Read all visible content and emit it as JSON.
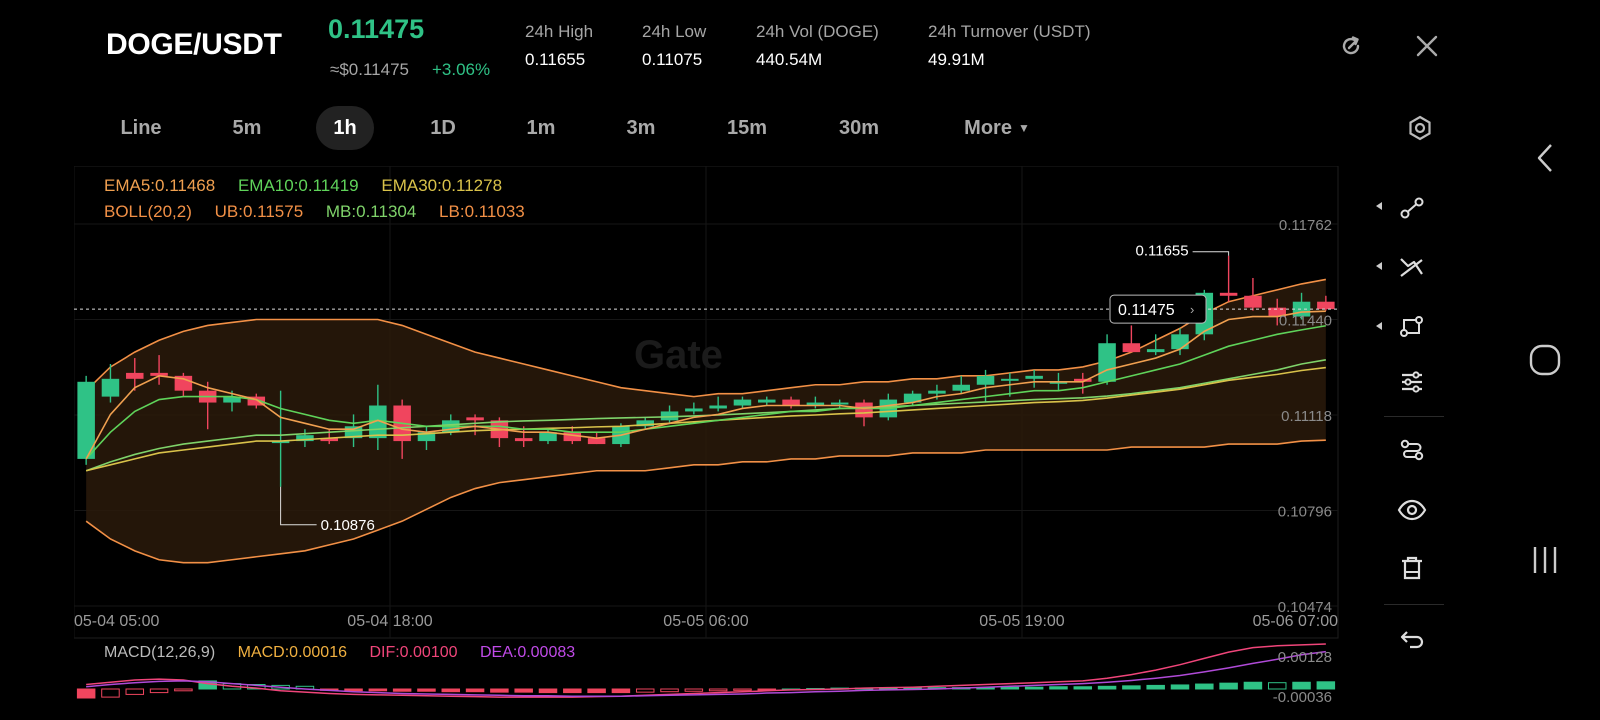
{
  "header": {
    "pair": "DOGE/USDT",
    "last_price": "0.11475",
    "approx_usd": "≈$0.11475",
    "change_pct": "+3.06%",
    "stats": [
      {
        "label": "24h   High",
        "value": "0.11655"
      },
      {
        "label": "24h   Low",
        "value": "0.11075"
      },
      {
        "label": "24h   Vol (DOGE)",
        "value": "440.54M"
      },
      {
        "label": "24h   Turnover (USDT)",
        "value": "49.91M"
      }
    ]
  },
  "timeframes": [
    "Line",
    "5m",
    "1h",
    "1D",
    "1m",
    "3m",
    "15m",
    "30m",
    "More"
  ],
  "active_timeframe": "1h",
  "indicators": {
    "ema5": "EMA5:0.11468",
    "ema10": "EMA10:0.11419",
    "ema30": "EMA30:0.11278",
    "boll": "BOLL(20,2)",
    "ub": "UB:0.11575",
    "mb": "MB:0.11304",
    "lb": "LB:0.11033"
  },
  "watermark": "Gate",
  "price_axis": [
    "0.11762",
    "0.11440",
    "0.11118",
    "0.10796",
    "0.10474"
  ],
  "time_axis": [
    "05-04 05:00",
    "05-04 18:00",
    "05-05 06:00",
    "05-05 19:00",
    "05-06 07:00"
  ],
  "annotations": {
    "high": "0.11655",
    "low": "0.10876",
    "current": "0.11475"
  },
  "macd": {
    "title": "MACD(12,26,9)",
    "macd": "MACD:0.00016",
    "dif": "DIF:0.00100",
    "dea": "DEA:0.00083",
    "axis_top": "0.00128",
    "axis_bottom": "-0.00036"
  },
  "colors": {
    "up": "#2fc286",
    "down": "#f0455e",
    "ema5": "#f0a050",
    "ema10": "#5fd35a",
    "ema30": "#d9c24a",
    "boll": "#f29046",
    "mb": "#7fd36a",
    "dif": "#f0457a",
    "dea": "#b04ad8"
  },
  "chart_data": {
    "type": "candlestick",
    "interval": "1h",
    "ylim": [
      0.10474,
      0.11762
    ],
    "candles": [
      {
        "o": 0.1097,
        "h": 0.1125,
        "l": 0.1095,
        "c": 0.1123
      },
      {
        "o": 0.1118,
        "h": 0.1129,
        "l": 0.1116,
        "c": 0.1124
      },
      {
        "o": 0.1126,
        "h": 0.1131,
        "l": 0.112,
        "c": 0.1124
      },
      {
        "o": 0.1126,
        "h": 0.1132,
        "l": 0.1122,
        "c": 0.1125
      },
      {
        "o": 0.1125,
        "h": 0.1126,
        "l": 0.1118,
        "c": 0.112
      },
      {
        "o": 0.112,
        "h": 0.1123,
        "l": 0.1107,
        "c": 0.1116
      },
      {
        "o": 0.1116,
        "h": 0.112,
        "l": 0.1113,
        "c": 0.1118
      },
      {
        "o": 0.1118,
        "h": 0.1119,
        "l": 0.1114,
        "c": 0.1115
      },
      {
        "o": 0.1103,
        "h": 0.112,
        "l": 0.10876,
        "c": 0.1103
      },
      {
        "o": 0.1103,
        "h": 0.1107,
        "l": 0.1101,
        "c": 0.1105
      },
      {
        "o": 0.1104,
        "h": 0.1107,
        "l": 0.1102,
        "c": 0.1103
      },
      {
        "o": 0.1104,
        "h": 0.1112,
        "l": 0.1101,
        "c": 0.1108
      },
      {
        "o": 0.1104,
        "h": 0.1122,
        "l": 0.11,
        "c": 0.1115
      },
      {
        "o": 0.1115,
        "h": 0.1117,
        "l": 0.1097,
        "c": 0.1103
      },
      {
        "o": 0.1103,
        "h": 0.1108,
        "l": 0.11,
        "c": 0.1106
      },
      {
        "o": 0.1106,
        "h": 0.1112,
        "l": 0.1105,
        "c": 0.111
      },
      {
        "o": 0.1111,
        "h": 0.1112,
        "l": 0.1105,
        "c": 0.111
      },
      {
        "o": 0.111,
        "h": 0.1111,
        "l": 0.1101,
        "c": 0.1104
      },
      {
        "o": 0.1104,
        "h": 0.1108,
        "l": 0.1101,
        "c": 0.1103
      },
      {
        "o": 0.1103,
        "h": 0.1107,
        "l": 0.1102,
        "c": 0.1106
      },
      {
        "o": 0.1106,
        "h": 0.1108,
        "l": 0.1102,
        "c": 0.1103
      },
      {
        "o": 0.1104,
        "h": 0.1106,
        "l": 0.1102,
        "c": 0.1102
      },
      {
        "o": 0.1102,
        "h": 0.1109,
        "l": 0.1101,
        "c": 0.1108
      },
      {
        "o": 0.1108,
        "h": 0.1111,
        "l": 0.1107,
        "c": 0.111
      },
      {
        "o": 0.111,
        "h": 0.1115,
        "l": 0.1109,
        "c": 0.1113
      },
      {
        "o": 0.1113,
        "h": 0.1116,
        "l": 0.1112,
        "c": 0.1114
      },
      {
        "o": 0.1114,
        "h": 0.1118,
        "l": 0.1113,
        "c": 0.1115
      },
      {
        "o": 0.1115,
        "h": 0.1118,
        "l": 0.1114,
        "c": 0.1117
      },
      {
        "o": 0.1116,
        "h": 0.1118,
        "l": 0.1115,
        "c": 0.1117
      },
      {
        "o": 0.1117,
        "h": 0.1118,
        "l": 0.1114,
        "c": 0.1115
      },
      {
        "o": 0.1115,
        "h": 0.1118,
        "l": 0.1114,
        "c": 0.1116
      },
      {
        "o": 0.1116,
        "h": 0.1117,
        "l": 0.1114,
        "c": 0.1116
      },
      {
        "o": 0.1116,
        "h": 0.1117,
        "l": 0.1108,
        "c": 0.1111
      },
      {
        "o": 0.1111,
        "h": 0.1119,
        "l": 0.111,
        "c": 0.1117
      },
      {
        "o": 0.1116,
        "h": 0.112,
        "l": 0.1115,
        "c": 0.1119
      },
      {
        "o": 0.1119,
        "h": 0.1122,
        "l": 0.1117,
        "c": 0.112
      },
      {
        "o": 0.112,
        "h": 0.1125,
        "l": 0.1119,
        "c": 0.1122
      },
      {
        "o": 0.1122,
        "h": 0.1127,
        "l": 0.1116,
        "c": 0.1125
      },
      {
        "o": 0.1124,
        "h": 0.1126,
        "l": 0.1118,
        "c": 0.1124
      },
      {
        "o": 0.1124,
        "h": 0.1127,
        "l": 0.1121,
        "c": 0.1125
      },
      {
        "o": 0.1123,
        "h": 0.1126,
        "l": 0.112,
        "c": 0.1123
      },
      {
        "o": 0.1124,
        "h": 0.1126,
        "l": 0.1119,
        "c": 0.1123
      },
      {
        "o": 0.1123,
        "h": 0.1139,
        "l": 0.1122,
        "c": 0.1136
      },
      {
        "o": 0.1136,
        "h": 0.1142,
        "l": 0.1133,
        "c": 0.1133
      },
      {
        "o": 0.1133,
        "h": 0.1139,
        "l": 0.1132,
        "c": 0.1134
      },
      {
        "o": 0.1134,
        "h": 0.1141,
        "l": 0.1132,
        "c": 0.1139
      },
      {
        "o": 0.1139,
        "h": 0.1154,
        "l": 0.1137,
        "c": 0.1153
      },
      {
        "o": 0.1153,
        "h": 0.11655,
        "l": 0.115,
        "c": 0.1152
      },
      {
        "o": 0.1152,
        "h": 0.1158,
        "l": 0.1147,
        "c": 0.1148
      },
      {
        "o": 0.1148,
        "h": 0.1151,
        "l": 0.1142,
        "c": 0.1145
      },
      {
        "o": 0.1145,
        "h": 0.1153,
        "l": 0.1144,
        "c": 0.115
      },
      {
        "o": 0.115,
        "h": 0.1152,
        "l": 0.1147,
        "c": 0.11475
      }
    ],
    "ema5": [
      0.1097,
      0.1112,
      0.1121,
      0.1125,
      0.1124,
      0.1121,
      0.1119,
      0.1117,
      0.1111,
      0.1109,
      0.1107,
      0.1107,
      0.111,
      0.1107,
      0.1106,
      0.1107,
      0.1108,
      0.1107,
      0.1106,
      0.1106,
      0.1105,
      0.1104,
      0.1105,
      0.1107,
      0.1109,
      0.1111,
      0.1112,
      0.1114,
      0.1115,
      0.1115,
      0.1115,
      0.1115,
      0.1114,
      0.1115,
      0.1116,
      0.1118,
      0.1119,
      0.1121,
      0.1122,
      0.1123,
      0.1123,
      0.1123,
      0.1127,
      0.1129,
      0.1131,
      0.1134,
      0.114,
      0.1144,
      0.1145,
      0.1145,
      0.11465,
      0.11468
    ],
    "ema10": [
      0.1097,
      0.1106,
      0.1113,
      0.1117,
      0.1118,
      0.1118,
      0.1118,
      0.1117,
      0.1114,
      0.1112,
      0.111,
      0.1109,
      0.111,
      0.1109,
      0.1108,
      0.1108,
      0.1108,
      0.1108,
      0.1107,
      0.1107,
      0.1106,
      0.1106,
      0.1106,
      0.1107,
      0.1108,
      0.1109,
      0.111,
      0.1111,
      0.1112,
      0.1113,
      0.1113,
      0.1114,
      0.1114,
      0.1114,
      0.1115,
      0.1116,
      0.1117,
      0.1118,
      0.1119,
      0.112,
      0.112,
      0.1121,
      0.1123,
      0.1125,
      0.1127,
      0.1129,
      0.1132,
      0.1135,
      0.1137,
      0.1139,
      0.11405,
      0.11419
    ],
    "ema30": [
      0.1093,
      0.1095,
      0.1097,
      0.1099,
      0.11,
      0.1101,
      0.1102,
      0.1103,
      0.1103,
      0.11035,
      0.1104,
      0.11045,
      0.1105,
      0.1105,
      0.11055,
      0.1106,
      0.11065,
      0.11068,
      0.1107,
      0.11073,
      0.11075,
      0.11078,
      0.1108,
      0.11085,
      0.1109,
      0.11095,
      0.111,
      0.11105,
      0.1111,
      0.11115,
      0.11118,
      0.11122,
      0.11125,
      0.1113,
      0.11135,
      0.1114,
      0.11145,
      0.1115,
      0.11155,
      0.1116,
      0.11163,
      0.11167,
      0.11175,
      0.11185,
      0.11195,
      0.11205,
      0.1122,
      0.11235,
      0.11245,
      0.11255,
      0.11268,
      0.11278
    ],
    "mb": [
      0.1093,
      0.1096,
      0.10985,
      0.11005,
      0.1102,
      0.1103,
      0.1104,
      0.1105,
      0.1105,
      0.11055,
      0.1106,
      0.11065,
      0.1107,
      0.11075,
      0.1108,
      0.11085,
      0.1109,
      0.11095,
      0.11098,
      0.111,
      0.11103,
      0.11106,
      0.11108,
      0.1111,
      0.11112,
      0.11115,
      0.11118,
      0.11122,
      0.11126,
      0.1113,
      0.11135,
      0.1114,
      0.11143,
      0.11146,
      0.1115,
      0.11154,
      0.11158,
      0.11162,
      0.11166,
      0.1117,
      0.11173,
      0.11176,
      0.11182,
      0.1119,
      0.112,
      0.1121,
      0.11225,
      0.1124,
      0.11255,
      0.1127,
      0.1129,
      0.11304
    ],
    "ub": [
      0.112,
      0.1128,
      0.1133,
      0.1137,
      0.114,
      0.1142,
      0.1143,
      0.1144,
      0.1144,
      0.1144,
      0.1144,
      0.1144,
      0.1144,
      0.1142,
      0.1139,
      0.1136,
      0.1133,
      0.1131,
      0.1129,
      0.1127,
      0.1125,
      0.1123,
      0.1121,
      0.112,
      0.1119,
      0.1118,
      0.1119,
      0.1119,
      0.112,
      0.1121,
      0.1122,
      0.1122,
      0.1123,
      0.1123,
      0.1124,
      0.1124,
      0.1125,
      0.1125,
      0.1126,
      0.1127,
      0.1127,
      0.1128,
      0.113,
      0.1133,
      0.1137,
      0.1141,
      0.1146,
      0.115,
      0.1152,
      0.1154,
      0.1156,
      0.11575
    ],
    "lb": [
      0.1076,
      0.107,
      0.1066,
      0.1063,
      0.1062,
      0.1062,
      0.1063,
      0.1064,
      0.1065,
      0.1066,
      0.1068,
      0.107,
      0.1073,
      0.1076,
      0.108,
      0.1084,
      0.1087,
      0.1089,
      0.109,
      0.1091,
      0.1092,
      0.1093,
      0.1093,
      0.1093,
      0.1094,
      0.1095,
      0.1095,
      0.1096,
      0.1096,
      0.1097,
      0.1097,
      0.1098,
      0.1098,
      0.1098,
      0.1099,
      0.1099,
      0.1099,
      0.11,
      0.11,
      0.11,
      0.11,
      0.11,
      0.11,
      0.1101,
      0.1101,
      0.1101,
      0.1101,
      0.1102,
      0.1102,
      0.1102,
      0.1103,
      0.11033
    ],
    "macd_hist": [
      -0.0002,
      -0.00018,
      -0.00012,
      -8e-05,
      -4e-05,
      0.00018,
      0.00012,
      0.0001,
      8e-05,
      6e-05,
      -3e-05,
      -4e-05,
      -4e-05,
      -5e-05,
      -5e-05,
      -6e-05,
      -6e-05,
      -7e-05,
      -7e-05,
      -8e-05,
      -8e-05,
      -8e-05,
      -8e-05,
      -7e-05,
      -6e-05,
      -5e-05,
      -4e-05,
      -3e-05,
      -2e-05,
      0.0,
      1e-05,
      2e-05,
      2e-05,
      3e-05,
      3e-05,
      3e-05,
      3e-05,
      3e-05,
      4e-05,
      4e-05,
      5e-05,
      5e-05,
      6e-05,
      7e-05,
      8e-05,
      9e-05,
      0.00011,
      0.00013,
      0.00015,
      0.00014,
      0.00015,
      0.00016
    ],
    "dif": [
      0.0001,
      0.00015,
      0.0002,
      0.00022,
      0.0002,
      0.00012,
      6e-05,
      2e-05,
      -4e-05,
      -7e-05,
      -0.0001,
      -0.00012,
      -0.00013,
      -0.00014,
      -0.00015,
      -0.00016,
      -0.00017,
      -0.00018,
      -0.00018,
      -0.00018,
      -0.00018,
      -0.00017,
      -0.00016,
      -0.00014,
      -0.00012,
      -0.0001,
      -8e-05,
      -6e-05,
      -4e-05,
      -2e-05,
      -1e-05,
      0.0,
      2e-05,
      3e-05,
      4e-05,
      6e-05,
      8e-05,
      0.0001,
      0.00012,
      0.00014,
      0.00016,
      0.00018,
      0.00024,
      0.00032,
      0.00042,
      0.00054,
      0.00068,
      0.00082,
      0.00092,
      0.00096,
      0.00098,
      0.001
    ],
    "dea": [
      5e-05,
      0.0001,
      0.00014,
      0.00017,
      0.00018,
      0.00016,
      0.00012,
      8e-05,
      4e-05,
      0.0,
      -3e-05,
      -6e-05,
      -8e-05,
      -0.0001,
      -0.00011,
      -0.00012,
      -0.00013,
      -0.00014,
      -0.00015,
      -0.00015,
      -0.00016,
      -0.00016,
      -0.00016,
      -0.00015,
      -0.00014,
      -0.00013,
      -0.00012,
      -0.00011,
      -9e-05,
      -8e-05,
      -6e-05,
      -5e-05,
      -3e-05,
      -2e-05,
      -1e-05,
      0.0,
      2e-05,
      4e-05,
      6e-05,
      8e-05,
      0.0001,
      0.00012,
      0.00015,
      0.00019,
      0.00024,
      0.0003,
      0.00038,
      0.00047,
      0.00057,
      0.00066,
      0.00076,
      0.00083
    ]
  }
}
